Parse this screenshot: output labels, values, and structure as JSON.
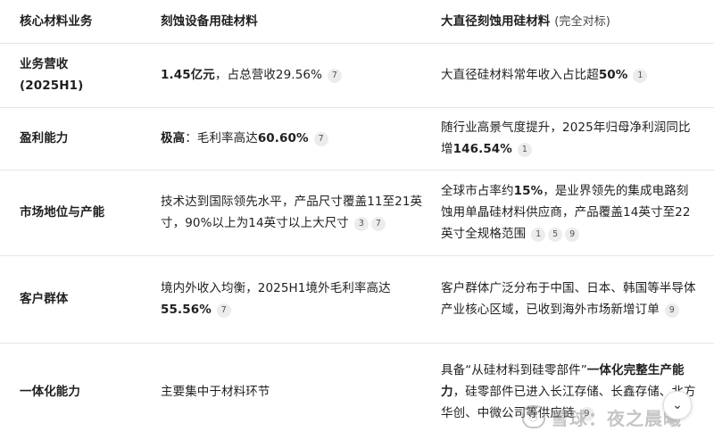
{
  "header": {
    "col1": "核心材料业务",
    "col2": "刻蚀设备用硅材料",
    "col3": "大直径刻蚀用硅材料",
    "col3_note": "(完全对标)"
  },
  "rows": [
    {
      "label": "业务营收 (2025H1)",
      "col2": [
        {
          "t": "1.45亿元",
          "b": true
        },
        {
          "t": "，占总营收29.56%",
          "b": false
        }
      ],
      "col2_cites": [
        "7"
      ],
      "col3": [
        {
          "t": "大直径硅材料常年收入占比超",
          "b": false
        },
        {
          "t": "50%",
          "b": true
        }
      ],
      "col3_cites": [
        "1"
      ]
    },
    {
      "label": "盈利能力",
      "col2": [
        {
          "t": "极高",
          "b": true
        },
        {
          "t": "：毛利率高达",
          "b": false
        },
        {
          "t": "60.60%",
          "b": true
        }
      ],
      "col2_cites": [
        "7"
      ],
      "col3": [
        {
          "t": "随行业高景气度提升，2025年归母净利润同比增",
          "b": false
        },
        {
          "t": "146.54%",
          "b": true
        }
      ],
      "col3_cites": [
        "1"
      ]
    },
    {
      "label": "市场地位与产能",
      "col2": [
        {
          "t": "技术达到国际领先水平，产品尺寸覆盖11至21英寸，90%以上为14英寸以上大尺寸",
          "b": false
        }
      ],
      "col2_cites": [
        "3",
        "7"
      ],
      "col3": [
        {
          "t": "全球市占率约",
          "b": false
        },
        {
          "t": "15%",
          "b": true
        },
        {
          "t": "，是业界领先的集成电路刻蚀用单晶硅材料供应商，产品覆盖14英寸至22英寸全规格范围",
          "b": false
        }
      ],
      "col3_cites": [
        "1",
        "5",
        "9"
      ]
    },
    {
      "label": "客户群体",
      "col2": [
        {
          "t": "境内外收入均衡，2025H1境外毛利率高达",
          "b": false
        },
        {
          "t": "55.56%",
          "b": true
        }
      ],
      "col2_cites": [
        "7"
      ],
      "col3": [
        {
          "t": "客户群体广泛分布于中国、日本、韩国等半导体产业核心区域，已收到海外市场新增订单",
          "b": false
        }
      ],
      "col3_cites": [
        "9"
      ]
    },
    {
      "label": "一体化能力",
      "col2": [
        {
          "t": "主要集中于材料环节",
          "b": false
        }
      ],
      "col2_cites": [],
      "col3": [
        {
          "t": "具备“从硅材料到硅零部件”",
          "b": false
        },
        {
          "t": "一体化完整生产能力",
          "b": true
        },
        {
          "t": "，硅零部件已进入长江存储、长鑫存储、北方华创、中微公司等供应链",
          "b": false
        }
      ],
      "col3_cites": [
        "9"
      ]
    }
  ],
  "scroll_button": {
    "icon": "chevron-down-icon",
    "glyph": "⌄"
  },
  "watermark": {
    "text": "雪球：夜之晨曦",
    "logo": "snowball-logo-icon"
  }
}
